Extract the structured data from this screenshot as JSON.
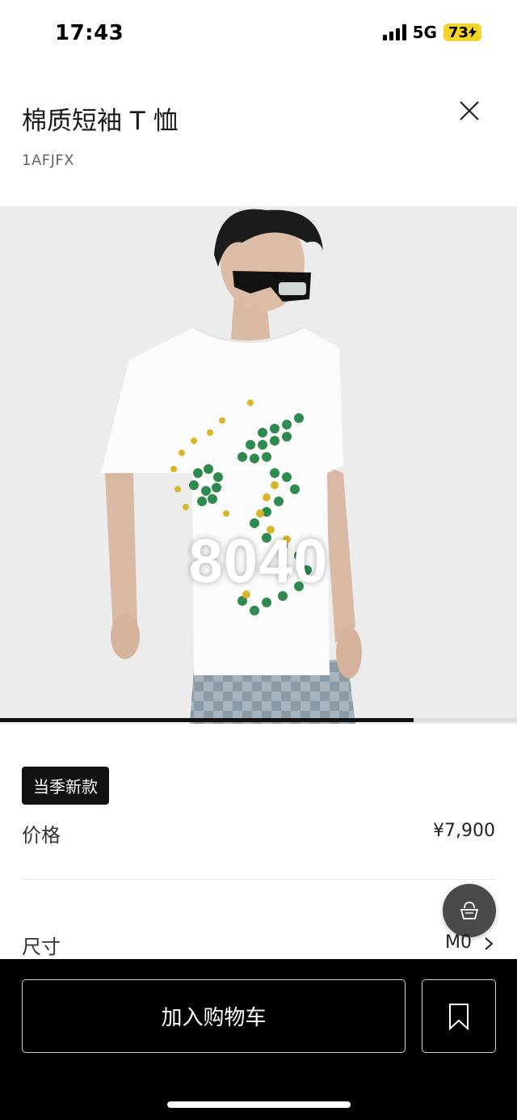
{
  "status_bar": {
    "time": "17:43",
    "network": "5G",
    "battery": "73",
    "battery_color": "#f5d327"
  },
  "header": {
    "title": "棉质短袖 T 恤",
    "sku": "1AFJFX",
    "close_icon": "close-icon"
  },
  "product_image": {
    "watermark": "8040",
    "gallery_progress": 0.8
  },
  "info": {
    "badge": "当季新款",
    "price_label": "价格",
    "price_value": "¥7,900",
    "size_label": "尺寸",
    "size_value": "M0"
  },
  "bottom_bar": {
    "add_to_cart": "加入购物车",
    "bookmark_icon": "bookmark-icon",
    "bag_icon": "shopping-bag-icon"
  }
}
